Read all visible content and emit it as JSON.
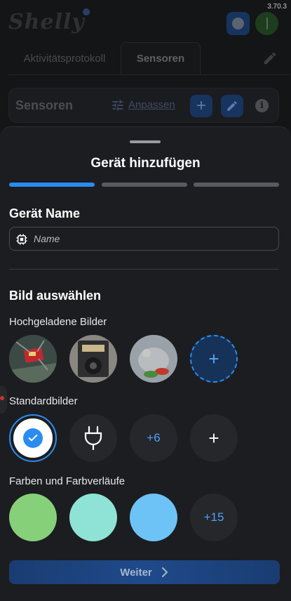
{
  "app": {
    "version": "3.70.3",
    "logo_text": "Shelly",
    "tabs": [
      {
        "label": "Aktivitätsprotokoll"
      },
      {
        "label": "Sensoren"
      }
    ],
    "sensor_section": {
      "title": "Sensoren",
      "adjust_label": "Anpassen",
      "plus_label": "+",
      "info_label": "i"
    }
  },
  "sheet": {
    "title": "Gerät hinzufügen",
    "steps": {
      "total": 3,
      "active": 1
    },
    "name_section": {
      "label": "Gerät Name",
      "placeholder": "Name"
    },
    "image_section": {
      "label": "Bild auswählen",
      "uploaded": {
        "label": "Hochgeladene Bilder",
        "add_label": "+"
      },
      "defaults": {
        "label": "Standardbilder",
        "more_label": "+6",
        "add_label": "+"
      },
      "colors": {
        "label": "Farben und Farbverläufe",
        "swatches": [
          "#86d07a",
          "#8ee3d6",
          "#6dc3f6"
        ],
        "more_label": "+15"
      }
    },
    "next_button": {
      "label": "Weiter"
    }
  },
  "colors": {
    "accent": "#2b8cf0",
    "background": "#1c1d20"
  }
}
